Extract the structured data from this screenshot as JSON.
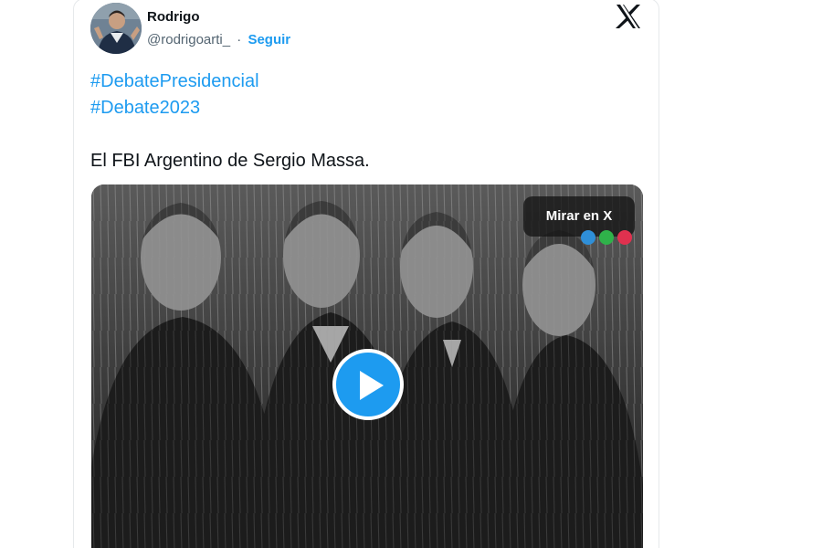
{
  "tweet": {
    "author_name": "Rodrigo",
    "handle": "@rodrigoarti_",
    "separator": "·",
    "follow_label": "Seguir",
    "hashtags": [
      "#DebatePresidencial",
      "#Debate2023"
    ],
    "body": "El FBI Argentino de Sergio Massa."
  },
  "media": {
    "watch_label": "Mirar en X"
  },
  "colors": {
    "accent": "#1d9bf0",
    "text": "#0f1419",
    "muted": "#536471"
  },
  "icons": {
    "brand": "x-logo-icon",
    "play": "play-icon"
  }
}
